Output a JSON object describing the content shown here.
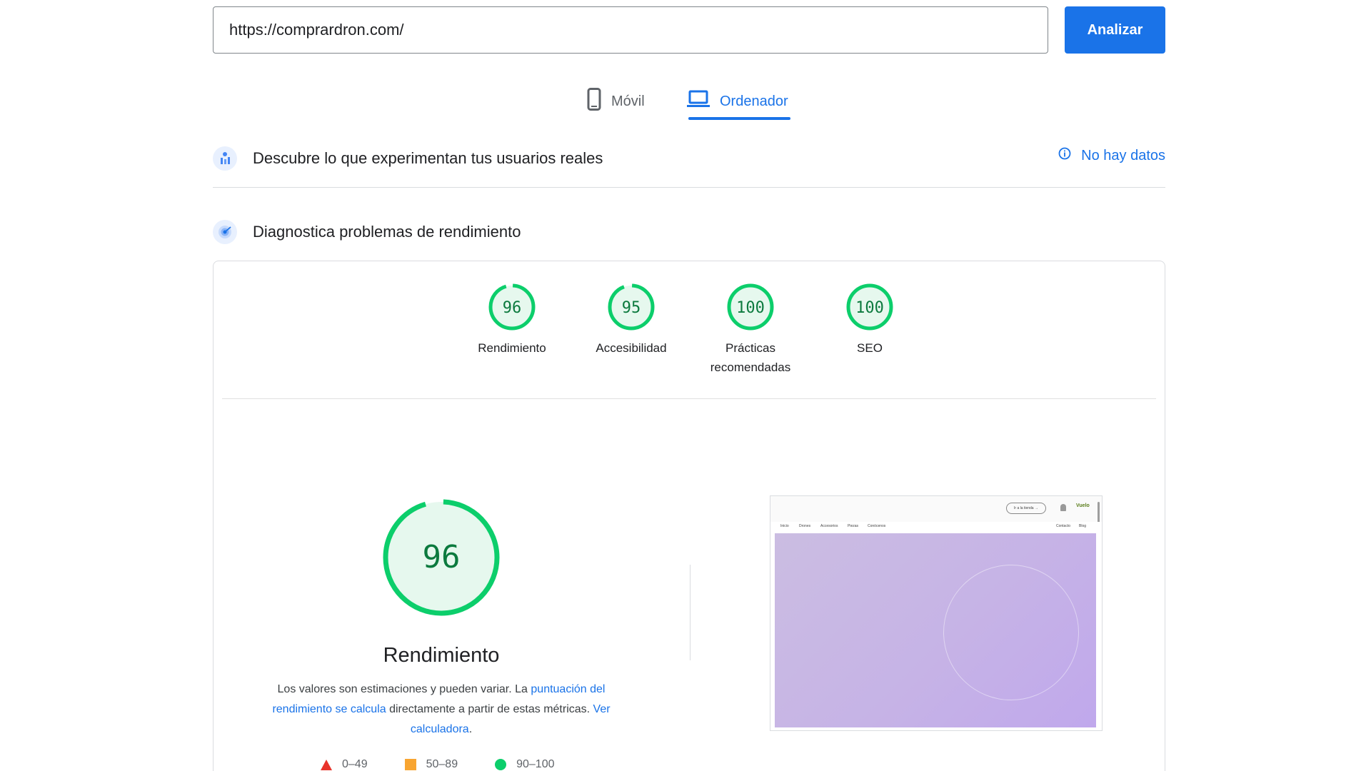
{
  "search": {
    "url_value": "https://comprardron.com/",
    "analyze_label": "Analizar"
  },
  "tabs": [
    {
      "label": "Móvil",
      "icon": "phone-icon",
      "active": false
    },
    {
      "label": "Ordenador",
      "icon": "laptop-icon",
      "active": true
    }
  ],
  "field_data": {
    "title": "Descubre lo que experimentan tus usuarios reales",
    "status_label": "No hay datos",
    "status_icon": "info-icon"
  },
  "lab_data": {
    "title": "Diagnostica problemas de rendimiento"
  },
  "scores": [
    {
      "value": "96",
      "score": 96,
      "label": "Rendimiento"
    },
    {
      "value": "95",
      "score": 95,
      "label": "Accesibilidad"
    },
    {
      "value": "100",
      "score": 100,
      "label": "Prácticas recomendadas"
    },
    {
      "value": "100",
      "score": 100,
      "label": "SEO"
    }
  ],
  "performance": {
    "score": "96",
    "score_value": 96,
    "title": "Rendimiento",
    "desc_1": "Los valores son estimaciones y pueden variar. La ",
    "link_1": "puntuación del rendimiento se calcula",
    "desc_2": " directamente a partir de estas métricas. ",
    "link_2": "Ver calculadora",
    "desc_3": "."
  },
  "legend": [
    {
      "range": "0–49",
      "color": "#e8332b",
      "shape": "triangle"
    },
    {
      "range": "50–89",
      "color": "#f8a531",
      "shape": "square"
    },
    {
      "range": "90–100",
      "color": "#0cce6b",
      "shape": "circle"
    }
  ],
  "thumbnail": {
    "button": "Ir a la tienda →",
    "logo": "Vuelo",
    "nav": [
      "Inicio",
      "Drones",
      "Accesorios",
      "Piezas",
      "Conócenos",
      "Contacto",
      "Blog"
    ]
  },
  "colors": {
    "accent": "#1a73e8",
    "pass": "#0cce6b",
    "pass_text": "#0c7a3e",
    "pass_fill": "#e6f8ee"
  }
}
